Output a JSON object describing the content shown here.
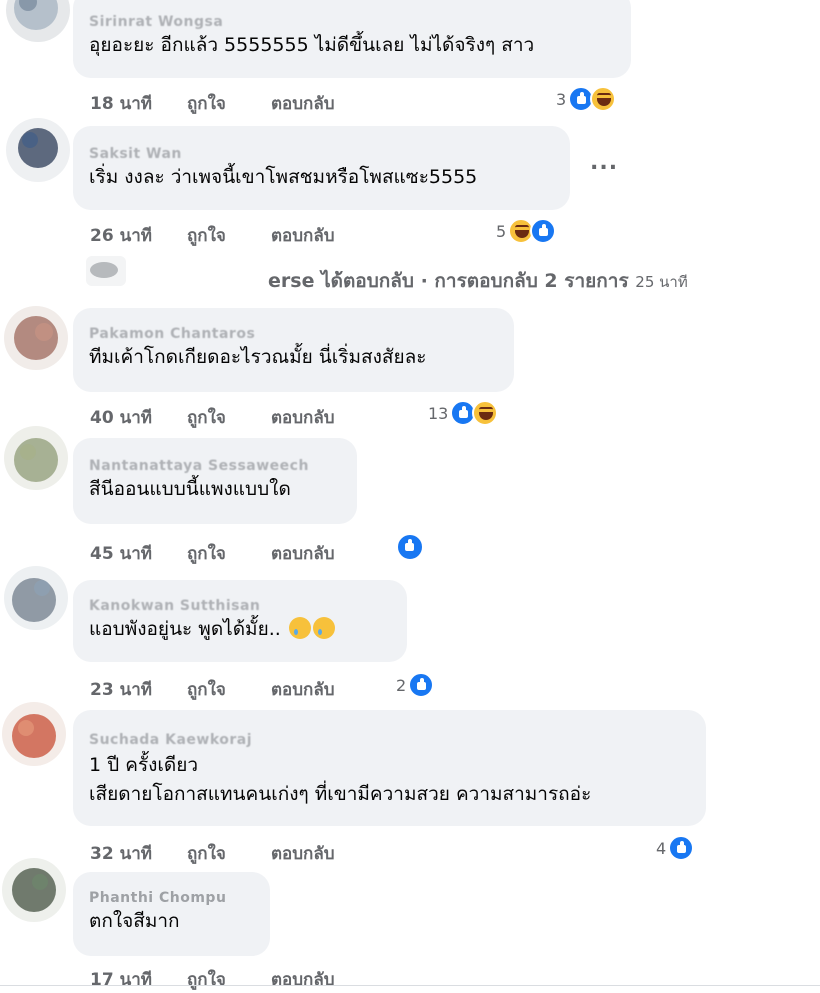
{
  "comments": [
    {
      "author": "Sirinrat Wongsa",
      "text": [
        "อุยอะยะ อีกแล้ว 5555555 ไม่ดีขึ้นเลย ไม่ได้จริงๆ สาว"
      ],
      "time": "18 นาที",
      "like": "ถูกใจ",
      "reply": "ตอบกลับ",
      "reaction_count": "3",
      "reactions": [
        "like",
        "haha"
      ]
    },
    {
      "author": "Saksit Wan",
      "text": [
        "เริ่ม งงละ ว่าเพจนี้เขาโพสชมหรือโพสแซะ5555"
      ],
      "time": "26 นาที",
      "like": "ถูกใจ",
      "reply": "ตอบกลับ",
      "reaction_count": "5",
      "reactions": [
        "haha",
        "like"
      ],
      "more": "..."
    },
    {
      "author": "Pakamon Chantaros",
      "text": [
        "ทีมเค้าโกดเกียดอะไรวณมั้ย นี่เริ่มสงสัยละ"
      ],
      "time": "40 นาที",
      "like": "ถูกใจ",
      "reply": "ตอบกลับ",
      "reaction_count": "13",
      "reactions": [
        "like",
        "haha"
      ]
    },
    {
      "author": "Nantanattaya Sessaweech",
      "text": [
        "สีนีออนแบบนี้แพงแบบใด"
      ],
      "time": "45 นาที",
      "like": "ถูกใจ",
      "reply": "ตอบกลับ",
      "reaction_count": "",
      "reactions": [
        "like"
      ]
    },
    {
      "author": "Kanokwan Sutthisan",
      "text": [
        "แอบพังอยู่นะ พูดได้มั้ย.."
      ],
      "time": "23 นาที",
      "like": "ถูกใจ",
      "reply": "ตอบกลับ",
      "reaction_count": "2",
      "reactions": [
        "like"
      ]
    },
    {
      "author": "Suchada Kaewkoraj",
      "text": [
        "1 ปี ครั้งเดียว",
        "เสียดายโอกาสแทนคนเก่งๆ ที่เขามีความสวย ความสามารถอ่ะ"
      ],
      "time": "32 นาที",
      "like": "ถูกใจ",
      "reply": "ตอบกลับ",
      "reaction_count": "4",
      "reactions": [
        "like"
      ]
    },
    {
      "author": "Phanthi Chompu",
      "text": [
        "ตกใจสีมาก"
      ],
      "time": "17 นาที",
      "like": "ถูกใจ",
      "reply": "ตอบกลับ",
      "reaction_count": "",
      "reactions": []
    }
  ],
  "reply_summary": {
    "prefix": "erse ได้ตอบกลับ · การตอบกลับ 2 รายการ",
    "time": "25 นาที"
  },
  "colors": {
    "bubble": "#f0f2f5",
    "meta": "#65676b",
    "like_blue": "#1877f2",
    "haha_yellow": "#f7c13b"
  }
}
